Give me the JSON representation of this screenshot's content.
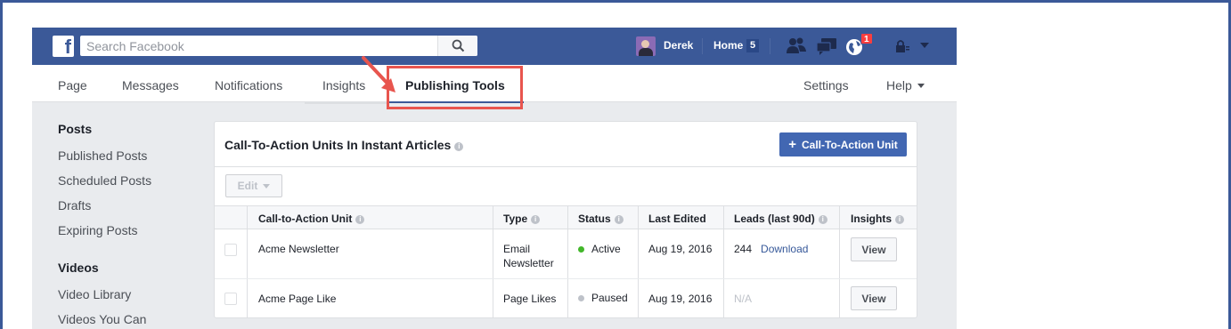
{
  "topbar": {
    "search_placeholder": "Search Facebook",
    "user_name": "Derek",
    "home_label": "Home",
    "home_count": "5",
    "notifications_count": "1",
    "brand_color": "#3b5998"
  },
  "tabs": [
    {
      "label": "Page"
    },
    {
      "label": "Messages"
    },
    {
      "label": "Notifications"
    },
    {
      "label": "Insights"
    },
    {
      "label": "Publishing Tools",
      "active": true
    },
    {
      "label": "Settings"
    },
    {
      "label": "Help"
    }
  ],
  "sidebar": {
    "posts_heading": "Posts",
    "posts_items": [
      "Published Posts",
      "Scheduled Posts",
      "Drafts",
      "Expiring Posts"
    ],
    "videos_heading": "Videos",
    "videos_items": [
      "Video Library",
      "Videos You Can"
    ]
  },
  "panel": {
    "title": "Call-To-Action Units In Instant Articles",
    "add_button_label": "Call-To-Action Unit",
    "edit_label": "Edit",
    "columns": [
      "Call-to-Action Unit",
      "Type",
      "Status",
      "Last Edited",
      "Leads (last 90d)",
      "Insights"
    ],
    "rows": [
      {
        "unit": "Acme Newsletter",
        "type_line1": "Email",
        "type_line2": "Newsletter",
        "status": "Active",
        "status_color": "#42b72a",
        "last_edited": "Aug 19, 2016",
        "leads": "244",
        "leads_link": "Download",
        "insights_button": "View"
      },
      {
        "unit": "Acme Page Like",
        "type_line1": "Page Likes",
        "type_line2": "",
        "status": "Paused",
        "status_color": "#bec2c9",
        "last_edited": "Aug 19, 2016",
        "leads": "N/A",
        "leads_link": "",
        "insights_button": "View"
      }
    ]
  },
  "annotation_color": "#e8554e"
}
